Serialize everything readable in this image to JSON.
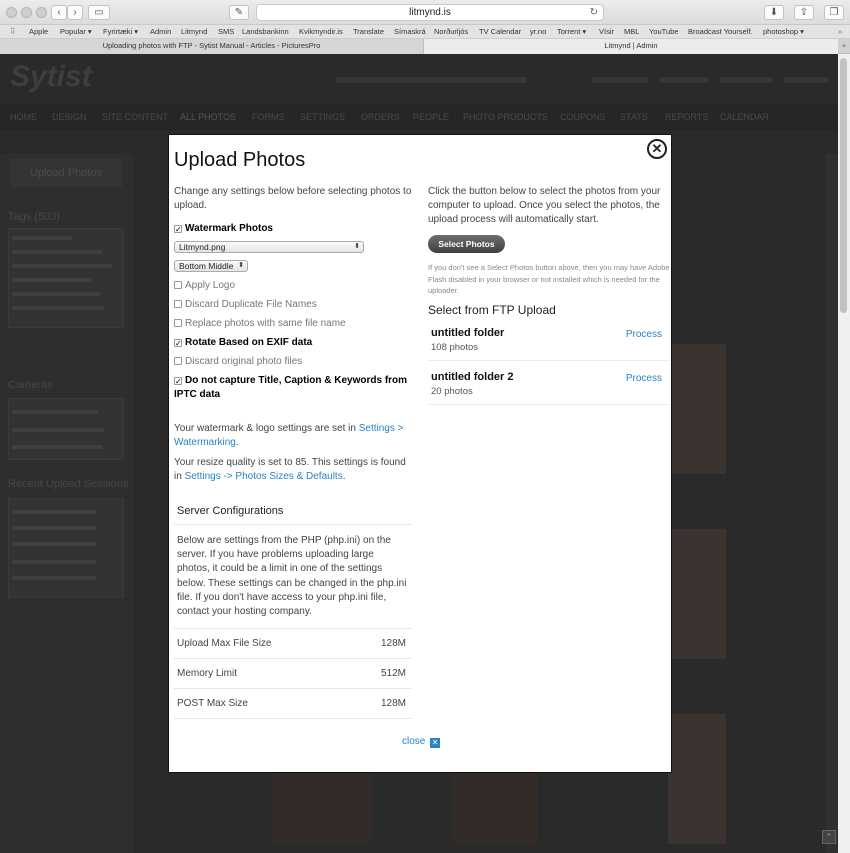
{
  "browser": {
    "url": "litmynd.is",
    "bookmarks": [
      "Apple",
      "Popular ▾",
      "Fyrirtæki ▾",
      "Admin",
      "Litmynd",
      "SMS",
      "Landsbankinn",
      "Kvikmyndir.is",
      "Translate",
      "Símaskrá",
      "Norðurljós",
      "TV Calendar",
      "yr.no",
      "Torrent ▾",
      "Vísir",
      "MBL",
      "YouTube",
      "Broadcast Yourself.",
      "photoshop ▾"
    ],
    "tabs": [
      {
        "label": "Uploading photos with FTP - Sytist Manual - Articles - PicturesPro",
        "active": false
      },
      {
        "label": "Litmynd | Admin",
        "active": true
      }
    ]
  },
  "background": {
    "logo": "Sytist",
    "nav": [
      "HOME",
      "DESIGN",
      "SITE CONTENT",
      "ALL PHOTOS",
      "FORMS",
      "SETTINGS",
      "ORDERS",
      "PEOPLE",
      "PHOTO PRODUCTS",
      "COUPONS",
      "STATS",
      "REPORTS",
      "CALENDAR"
    ],
    "upload_button": "Upload Photos",
    "tags_head": "Tags (503)",
    "cameras_head": "Cameras",
    "sessions_head": "Recent Upload Sessions"
  },
  "modal": {
    "title": "Upload Photos",
    "close_x": "✕",
    "intro": "Change any settings below before selecting photos to upload.",
    "options": {
      "watermark": {
        "label": "Watermark Photos",
        "checked": true
      },
      "watermark_file": "Litmynd.png",
      "watermark_position": "Bottom Middle",
      "apply_logo": {
        "label": "Apply Logo",
        "checked": false
      },
      "discard_duplicates": {
        "label": "Discard Duplicate File Names",
        "checked": false
      },
      "replace_same_name": {
        "label": "Replace photos with same file name",
        "checked": false
      },
      "rotate_exif": {
        "label": "Rotate Based on EXIF data",
        "checked": true
      },
      "discard_original": {
        "label": "Discard original photo files",
        "checked": false
      },
      "no_iptc": {
        "label": "Do not capture Title, Caption & Keywords from IPTC data",
        "checked": true
      }
    },
    "watermark_note": {
      "text": "Your watermark & logo settings are set in ",
      "link": "Settings > Watermarking",
      "end": "."
    },
    "resize_note": {
      "text": "Your resize quality is set to 85. This settings is found in ",
      "link": "Settings -> Photos Sizes & Defaults",
      "end": "."
    },
    "server": {
      "heading": "Server Configurations",
      "text": "Below are settings from the PHP (php.ini) on the server. If you have problems uploading large photos, it could be a limit in one of the settings below. These settings can be changed in the php.ini file. If you don't have access to your php.ini file, contact your hosting company.",
      "rows": [
        {
          "label": "Upload Max File Size",
          "value": "128M"
        },
        {
          "label": "Memory Limit",
          "value": "512M"
        },
        {
          "label": "POST Max Size",
          "value": "128M"
        }
      ]
    },
    "close_label": "close",
    "right": {
      "instructions": "Click the button below to select the photos from your computer to upload. Once you select the photos, the upload process will automatically start.",
      "select_button": "Select Photos",
      "flash_note": "If you don't see a Select Photos button above, then you may have Adobe Flash disabled in your browser or not installed which is needed for the uploader.",
      "ftp_heading": "Select from FTP Upload",
      "folders": [
        {
          "name": "untitled folder",
          "count": "108 photos",
          "action": "Process"
        },
        {
          "name": "untitled folder 2",
          "count": "20 photos",
          "action": "Process"
        }
      ]
    }
  }
}
